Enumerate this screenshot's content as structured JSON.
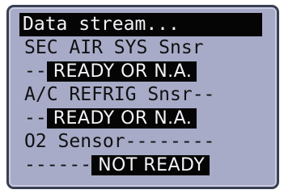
{
  "display": {
    "title": "Data stream...",
    "items": [
      {
        "label": "SEC AIR SYS Snsr",
        "dashes": "--",
        "status": "READY OR N.A."
      },
      {
        "label": "A/C REFRIG Snsr--",
        "dashes": "--",
        "status": "READY OR N.A."
      },
      {
        "label": "O2 Sensor--------",
        "dashes": "------",
        "status": "NOT READY"
      }
    ]
  },
  "colors": {
    "lcd_background": "#a7abc7",
    "bezel": "#3a3f54",
    "text": "#111111",
    "highlight_background": "#050505",
    "highlight_text": "#f2f3f7"
  }
}
